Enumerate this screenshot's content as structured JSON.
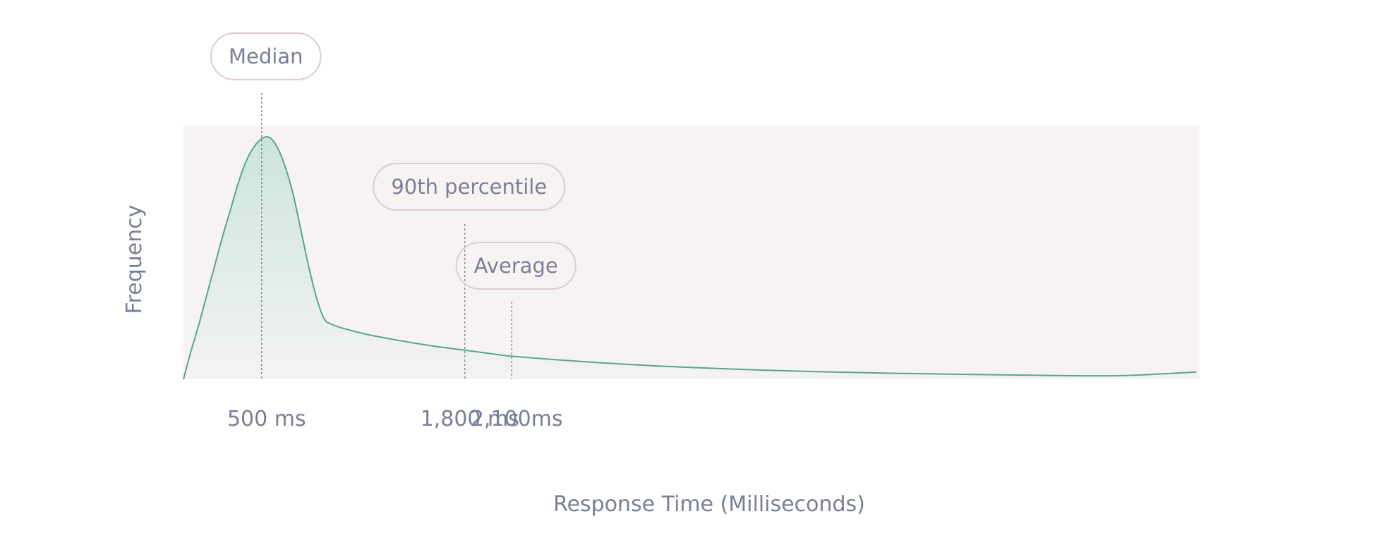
{
  "chart_data": {
    "type": "area",
    "title": "",
    "xlabel": "Response Time (Milliseconds)",
    "ylabel": "Frequency",
    "xlim": [
      0,
      6500
    ],
    "ylim": [
      0,
      1
    ],
    "grid": false,
    "series": [
      {
        "x": [
          0,
          50,
          100,
          150,
          200,
          250,
          300,
          350,
          400,
          450,
          500,
          550,
          600,
          650,
          700,
          750,
          800,
          850,
          900,
          950,
          1000,
          1100,
          1200,
          1400,
          1600,
          1800,
          2000,
          2100,
          2400,
          2800,
          3200,
          3600,
          4000,
          4500,
          5000,
          5500,
          6000,
          6480
        ],
        "values": [
          0.0,
          0.12,
          0.23,
          0.35,
          0.47,
          0.59,
          0.7,
          0.81,
          0.9,
          0.96,
          0.995,
          1.0,
          0.96,
          0.88,
          0.77,
          0.62,
          0.47,
          0.34,
          0.25,
          0.227,
          0.215,
          0.197,
          0.182,
          0.158,
          0.137,
          0.12,
          0.103,
          0.095,
          0.08,
          0.063,
          0.05,
          0.04,
          0.032,
          0.025,
          0.02,
          0.016,
          0.015,
          0.03
        ]
      }
    ],
    "markers": [
      {
        "label": "Median",
        "x": 500,
        "tick_label": "500 ms"
      },
      {
        "label": "90th percentile",
        "x": 1800,
        "tick_label": "1,800 ms"
      },
      {
        "label": "Average",
        "x": 2100,
        "tick_label": "2,100ms"
      }
    ],
    "colors": {
      "line": "#5aa58a",
      "fill_top": "#cce4dd",
      "fill_bottom": "#f3f3f2",
      "plot_bg": "#f7f3f3",
      "marker_line": "#8a8c93",
      "callout_border": "#ddcbd0",
      "text": "#7b7f96"
    }
  }
}
